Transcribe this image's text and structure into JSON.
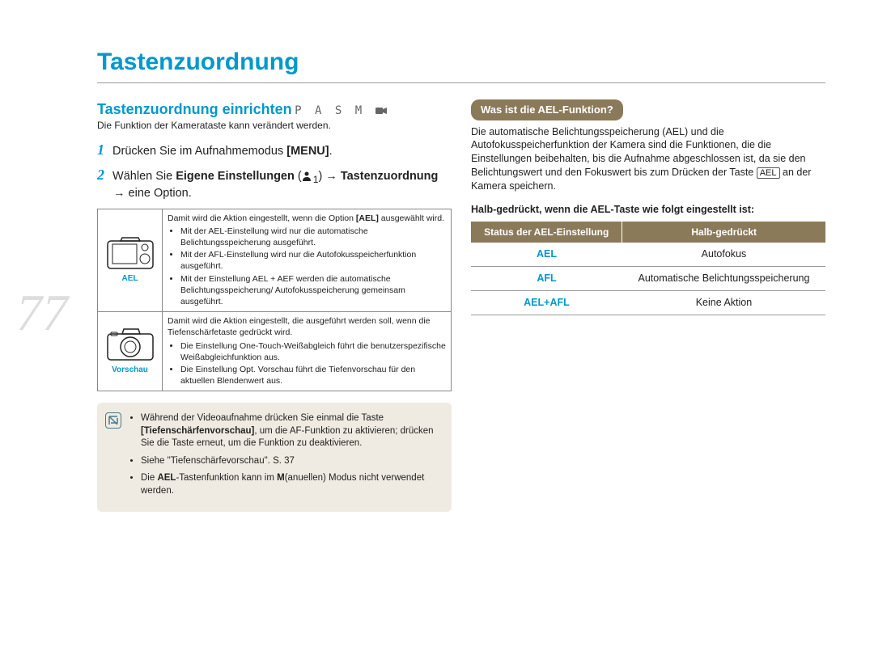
{
  "page_number": "77",
  "title": "Tastenzuordnung",
  "left": {
    "subtitle": "Tastenzuordnung einrichten",
    "mode_icons": "P A S M",
    "intro": "Die Funktion der Kamerataste kann verändert werden.",
    "step1_num": "1",
    "step1_text_a": "Drücken Sie im Aufnahmemodus ",
    "step1_menu": "MENU",
    "step1_text_b": ".",
    "step2_num": "2",
    "step2_text_a": "Wählen Sie ",
    "step2_bold1": "Eigene Einstellungen",
    "step2_text_b": " → ",
    "step2_bold2": "Tastenzuordnung",
    "step2_text_c": " → eine Option.",
    "user_sub": "1",
    "row1_label": "AEL",
    "row1_intro": "Damit wird die Aktion eingestellt, wenn die Option ",
    "row1_intro_b": "[AEL]",
    "row1_intro_c": " ausgewählt wird.",
    "row1_b1": "Mit der AEL-Einstellung wird nur die automatische Belichtungsspeicherung ausgeführt.",
    "row1_b2": "Mit der AFL-Einstellung wird nur die Autofokusspeicherfunktion ausgeführt.",
    "row1_b3": "Mit der Einstellung AEL + AEF werden die automatische Belichtungsspeicherung/ Autofokusspeicherung gemeinsam ausgeführt.",
    "row2_label": "Vorschau",
    "row2_intro": "Damit wird die Aktion eingestellt, die ausgeführt werden soll, wenn die Tiefenschärfetaste gedrückt wird.",
    "row2_b1": "Die Einstellung One-Touch-Weißabgleich führt die benutzerspezifische Weißabgleichfunktion aus.",
    "row2_b2": "Die Einstellung Opt. Vorschau führt die Tiefenvorschau für den aktuellen Blendenwert aus.",
    "note1_a": "Während der Videoaufnahme drücken Sie einmal die Taste ",
    "note1_b": "[Tiefenschärfenvorschau]",
    "note1_c": ", um die AF-Funktion zu aktivieren; drücken Sie die Taste erneut, um die Funktion zu deaktivieren.",
    "note2": "Siehe \"Tiefenschärfevorschau\". S. 37",
    "note3_a": "Die ",
    "note3_b": "AEL",
    "note3_c": "-Tastenfunktion kann im ",
    "note3_d": "M",
    "note3_e": "(anuellen) Modus nicht verwendet werden."
  },
  "right": {
    "badge": "Was ist die AEL-Funktion?",
    "para_a": "Die automatische Belichtungsspeicherung (AEL) und die Autofokusspeicherfunktion der Kamera sind die Funktionen, die die Einstellungen beibehalten, bis die Aufnahme abgeschlossen ist, da sie den Belichtungswert und den Fokuswert bis zum Drücken der Taste ",
    "para_key": "AEL",
    "para_b": " an der Kamera speichern.",
    "sub_bold": "Halb-gedrückt, wenn die AEL-Taste wie folgt eingestellt ist:",
    "th1": "Status der AEL-Einstellung",
    "th2": "Halb-gedrückt",
    "r1c1": "AEL",
    "r1c2": "Autofokus",
    "r2c1": "AFL",
    "r2c2": "Automatische Belichtungsspeicherung",
    "r3c1": "AEL+AFL",
    "r3c2": "Keine Aktion"
  }
}
